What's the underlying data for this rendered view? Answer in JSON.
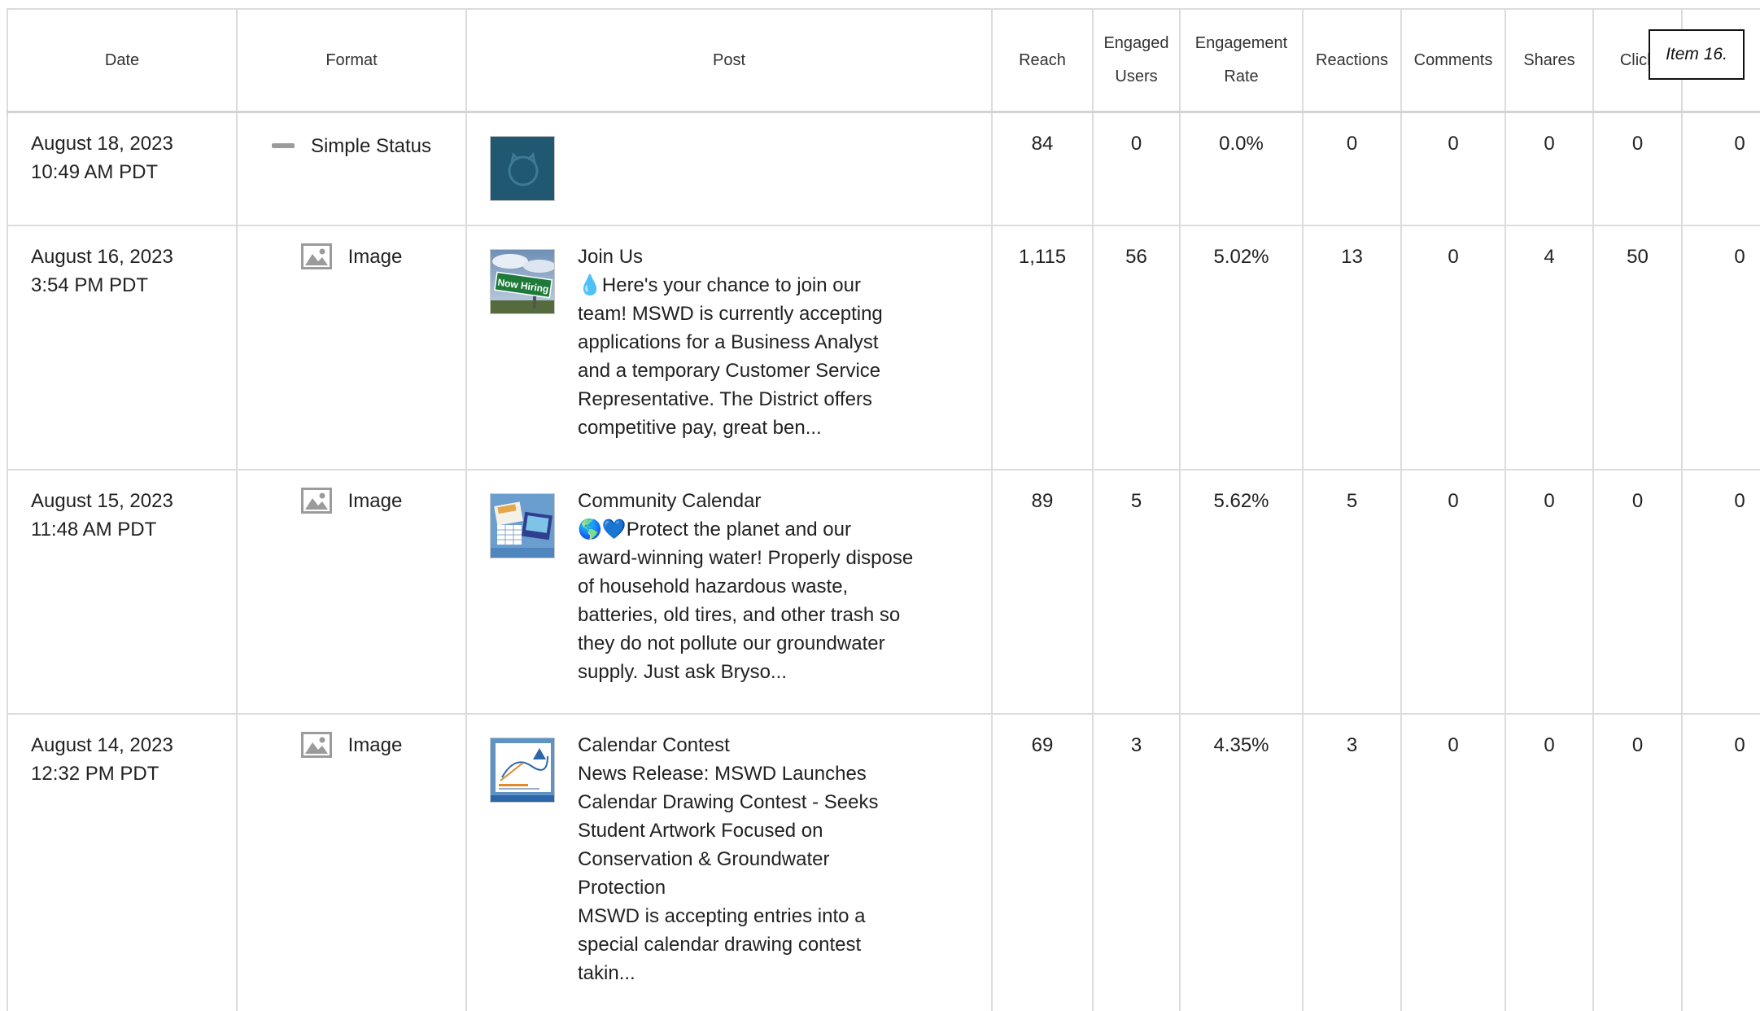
{
  "item_label": "Item 16.",
  "columns": {
    "date": "Date",
    "format": "Format",
    "post": "Post",
    "reach": "Reach",
    "engaged_users_line1": "Engaged",
    "engaged_users_line2": "Users",
    "engagement_rate_line1": "Engagement",
    "engagement_rate_line2": "Rate",
    "reactions": "Reactions",
    "comments": "Comments",
    "shares": "Shares",
    "clicks": "Click"
  },
  "rows": [
    {
      "date": "August 18, 2023",
      "time": "10:49 AM PDT",
      "format": "Simple Status",
      "format_icon": "dash-icon",
      "thumbnail": "logo-thumbnail",
      "title": "",
      "body": "",
      "reach": "84",
      "engaged_users": "0",
      "engagement_rate": "0.0%",
      "reactions": "0",
      "comments": "0",
      "shares": "0",
      "clicks": "0",
      "extra": "0"
    },
    {
      "date": "August 16, 2023",
      "time": "3:54 PM PDT",
      "format": "Image",
      "format_icon": "image-icon",
      "thumbnail": "now-hiring-thumbnail",
      "thumb_text": "Now Hiring",
      "title": "Join Us",
      "body": "💧Here's your chance to join our\nteam! MSWD is currently accepting\napplications for a Business Analyst\nand a temporary Customer Service\nRepresentative. The District offers\ncompetitive pay, great ben...",
      "reach": "1,115",
      "engaged_users": "56",
      "engagement_rate": "5.02%",
      "reactions": "13",
      "comments": "0",
      "shares": "4",
      "clicks": "50",
      "extra": "0"
    },
    {
      "date": "August 15, 2023",
      "time": "11:48 AM PDT",
      "format": "Image",
      "format_icon": "image-icon",
      "thumbnail": "calendar-thumbnail",
      "title": "Community Calendar",
      "body": "🌎💙Protect the planet and our\naward-winning water! Properly dispose\nof household hazardous waste,\nbatteries, old tires, and other trash so\nthey do not pollute our groundwater\nsupply. Just ask Bryso...",
      "reach": "89",
      "engaged_users": "5",
      "engagement_rate": "5.62%",
      "reactions": "5",
      "comments": "0",
      "shares": "0",
      "clicks": "0",
      "extra": "0"
    },
    {
      "date": "August 14, 2023",
      "time": "12:32 PM PDT",
      "format": "Image",
      "format_icon": "image-icon",
      "thumbnail": "news-release-thumbnail",
      "title": "Calendar Contest",
      "body": "News Release: MSWD Launches\nCalendar Drawing Contest - Seeks\nStudent Artwork Focused on\nConservation & Groundwater\nProtection\nMSWD is accepting entries into a\nspecial calendar drawing contest\ntakin...",
      "reach": "69",
      "engaged_users": "3",
      "engagement_rate": "4.35%",
      "reactions": "3",
      "comments": "0",
      "shares": "0",
      "clicks": "0",
      "extra": "0"
    }
  ],
  "colors": {
    "border": "#dcdcdc",
    "text": "#222222",
    "icon": "#9b9b9b",
    "logo_bg": "#1f5870"
  }
}
